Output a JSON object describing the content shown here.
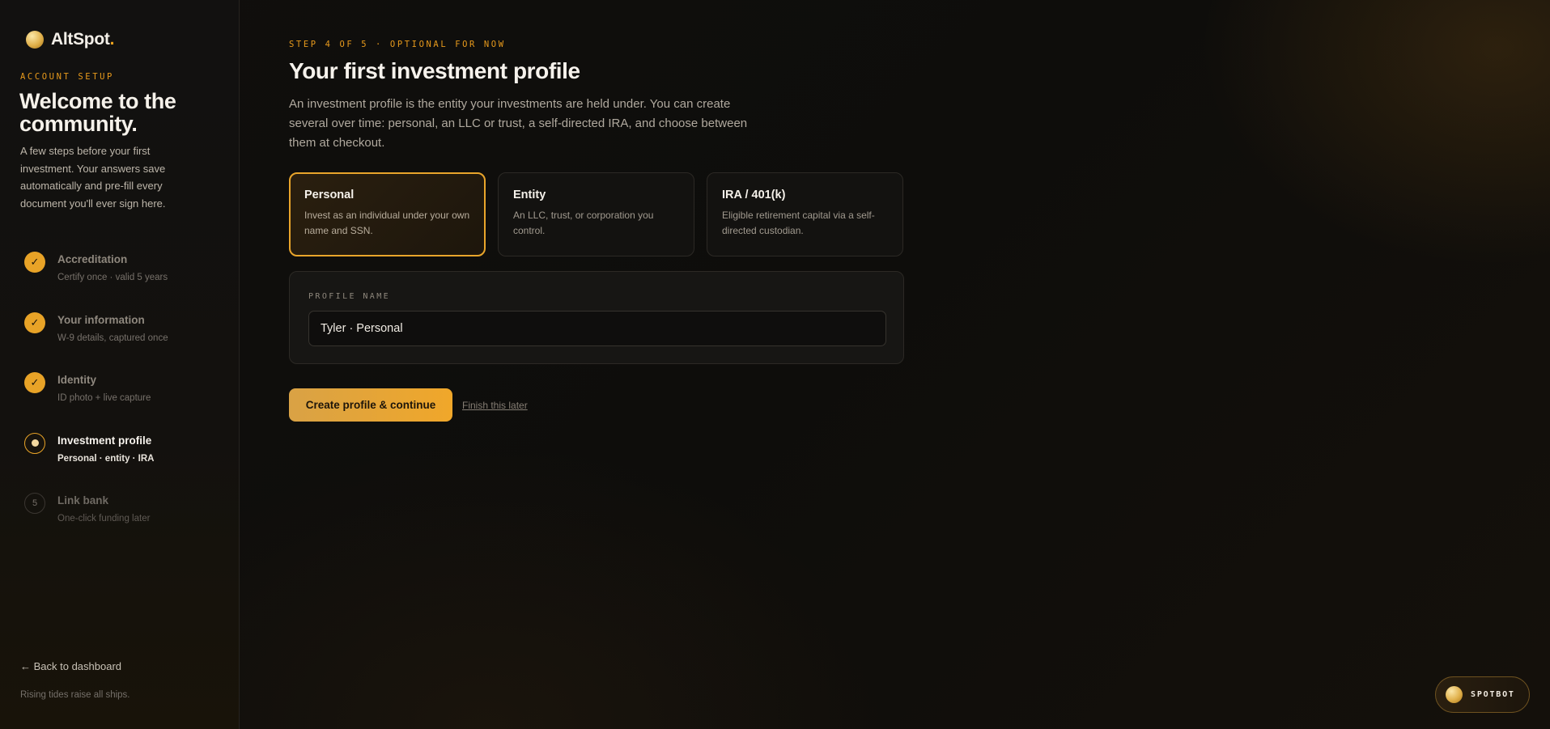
{
  "brand": {
    "name": "AltSpot",
    "dot": ".",
    "logo_icon": "gold-orb-icon"
  },
  "sidebar": {
    "eyebrow": "ACCOUNT SETUP",
    "title": "Welcome to the community.",
    "description": "A few steps before your first investment. Your answers save automatically and pre-fill every document you'll ever sign here.",
    "steps": [
      {
        "title": "Accreditation",
        "subtitle": "Certify once · valid 5 years",
        "status": "done",
        "marker": "✓"
      },
      {
        "title": "Your information",
        "subtitle": "W-9 details, captured once",
        "status": "done",
        "marker": "✓"
      },
      {
        "title": "Identity",
        "subtitle": "ID photo + live capture",
        "status": "done",
        "marker": "✓"
      },
      {
        "title": "Investment profile",
        "subtitle": "Personal · entity · IRA",
        "status": "active",
        "marker": ""
      },
      {
        "title": "Link bank",
        "subtitle": "One-click funding later",
        "status": "pending",
        "marker": "5"
      }
    ],
    "back_link": "← Back to dashboard",
    "tagline": "Rising tides raise all ships."
  },
  "main": {
    "eyebrow": "STEP 4 OF 5 · OPTIONAL FOR NOW",
    "title": "Your first investment profile",
    "description": "An investment profile is the entity your investments are held under. You can create several over time: personal, an LLC or trust, a self-directed IRA, and choose between them at checkout.",
    "profile_types": [
      {
        "title": "Personal",
        "description": "Invest as an individual under your own name and SSN.",
        "selected": true
      },
      {
        "title": "Entity",
        "description": "An LLC, trust, or corporation you control.",
        "selected": false
      },
      {
        "title": "IRA / 401(k)",
        "description": "Eligible retirement capital via a self-directed custodian.",
        "selected": false
      }
    ],
    "profile_name": {
      "label": "PROFILE NAME",
      "value": "Tyler · Personal"
    },
    "primary_button": "Create profile & continue",
    "secondary_link": "Finish this later"
  },
  "spotbot": {
    "label": "SPOTBOT",
    "icon": "gold-orb-icon"
  },
  "colors": {
    "accent": "#e9a52b",
    "background": "#0d0c0b",
    "text": "#ece7df"
  }
}
